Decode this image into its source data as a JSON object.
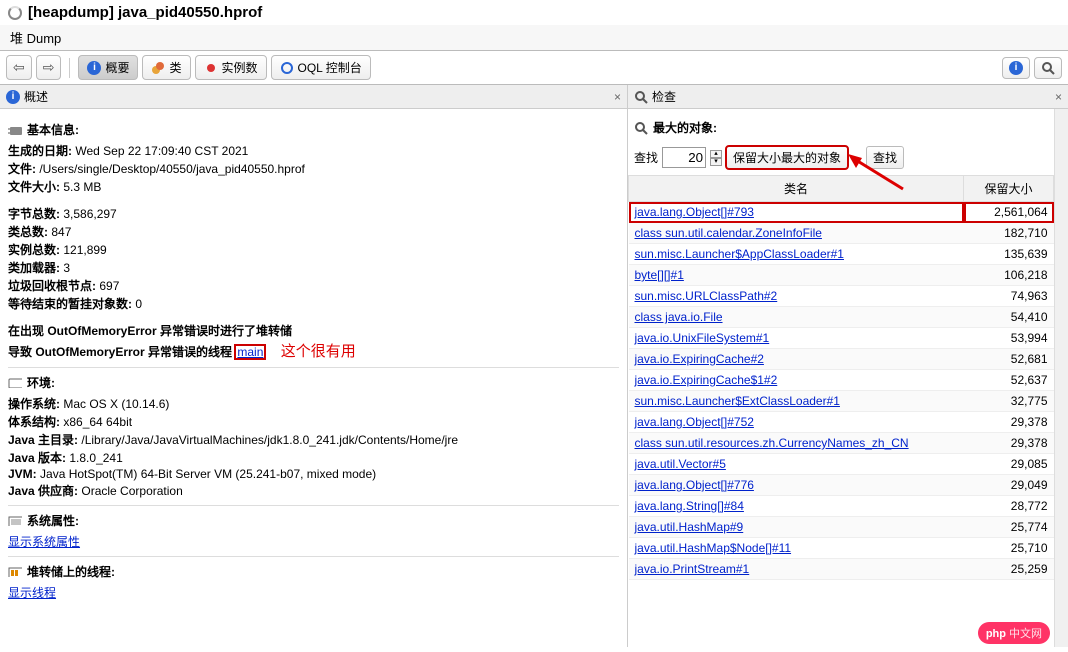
{
  "title": "[heapdump] java_pid40550.hprof",
  "subtitle": "堆 Dump",
  "toolbar": {
    "overview": "概要",
    "classes": "类",
    "instances": "实例数",
    "oql": "OQL 控制台"
  },
  "left": {
    "header": "概述",
    "basic_h": "基本信息:",
    "date_l": "生成的日期:",
    "date_v": "Wed Sep 22 17:09:40 CST 2021",
    "file_l": "文件:",
    "file_v": "/Users/single/Desktop/40550/java_pid40550.hprof",
    "size_l": "文件大小:",
    "size_v": "5.3 MB",
    "bytes_l": "字节总数:",
    "bytes_v": "3,586,297",
    "classes_l": "类总数:",
    "classes_v": "847",
    "inst_l": "实例总数:",
    "inst_v": "121,899",
    "loaders_l": "类加载器:",
    "loaders_v": "3",
    "gcroots_l": "垃圾回收根节点:",
    "gcroots_v": "697",
    "pending_l": "等待结束的暂挂对象数:",
    "pending_v": "0",
    "oom1": "在出现 OutOfMemoryError 异常错误时进行了堆转储",
    "oom2_a": "导致 OutOfMemoryError 异常错误的线程",
    "oom2_link": "main",
    "annot": "这个很有用",
    "env_h": "环境:",
    "os_l": "操作系统:",
    "os_v": "Mac OS X (10.14.6)",
    "arch_l": "体系结构:",
    "arch_v": "x86_64 64bit",
    "jhome_l": "Java 主目录:",
    "jhome_v": "/Library/Java/JavaVirtualMachines/jdk1.8.0_241.jdk/Contents/Home/jre",
    "jver_l": "Java 版本:",
    "jver_v": "1.8.0_241",
    "jvm_l": "JVM:",
    "jvm_v": "Java HotSpot(TM) 64-Bit Server VM (25.241-b07, mixed mode)",
    "vendor_l": "Java 供应商:",
    "vendor_v": "Oracle Corporation",
    "sysprops_h": "系统属性:",
    "sysprops_link": "显示系统属性",
    "threads_h": "堆转储上的线程:",
    "threads_link": "显示线程"
  },
  "right": {
    "header": "检查",
    "largest_h": "最大的对象:",
    "find_l": "查找",
    "find_n": "20",
    "mode": "保留大小最大的对象",
    "find_btn": "查找",
    "col_class": "类名",
    "col_retain": "保留大小",
    "rows": [
      {
        "c": "java.lang.Object[]#793",
        "v": "2,561,064",
        "hl": true
      },
      {
        "c": "class sun.util.calendar.ZoneInfoFile",
        "v": "182,710"
      },
      {
        "c": "sun.misc.Launcher$AppClassLoader#1",
        "v": "135,639"
      },
      {
        "c": "byte[][]#1",
        "v": "106,218"
      },
      {
        "c": "sun.misc.URLClassPath#2",
        "v": "74,963"
      },
      {
        "c": "class java.io.File",
        "v": "54,410"
      },
      {
        "c": "java.io.UnixFileSystem#1",
        "v": "53,994"
      },
      {
        "c": "java.io.ExpiringCache#2",
        "v": "52,681"
      },
      {
        "c": "java.io.ExpiringCache$1#2",
        "v": "52,637"
      },
      {
        "c": "sun.misc.Launcher$ExtClassLoader#1",
        "v": "32,775"
      },
      {
        "c": "java.lang.Object[]#752",
        "v": "29,378"
      },
      {
        "c": "class sun.util.resources.zh.CurrencyNames_zh_CN",
        "v": "29,378"
      },
      {
        "c": "java.util.Vector#5",
        "v": "29,085"
      },
      {
        "c": "java.lang.Object[]#776",
        "v": "29,049"
      },
      {
        "c": "java.lang.String[]#84",
        "v": "28,772"
      },
      {
        "c": "java.util.HashMap#9",
        "v": "25,774"
      },
      {
        "c": "java.util.HashMap$Node[]#11",
        "v": "25,710"
      },
      {
        "c": "java.io.PrintStream#1",
        "v": "25,259"
      }
    ]
  },
  "badge": {
    "a": "php",
    "b": "中文网"
  }
}
